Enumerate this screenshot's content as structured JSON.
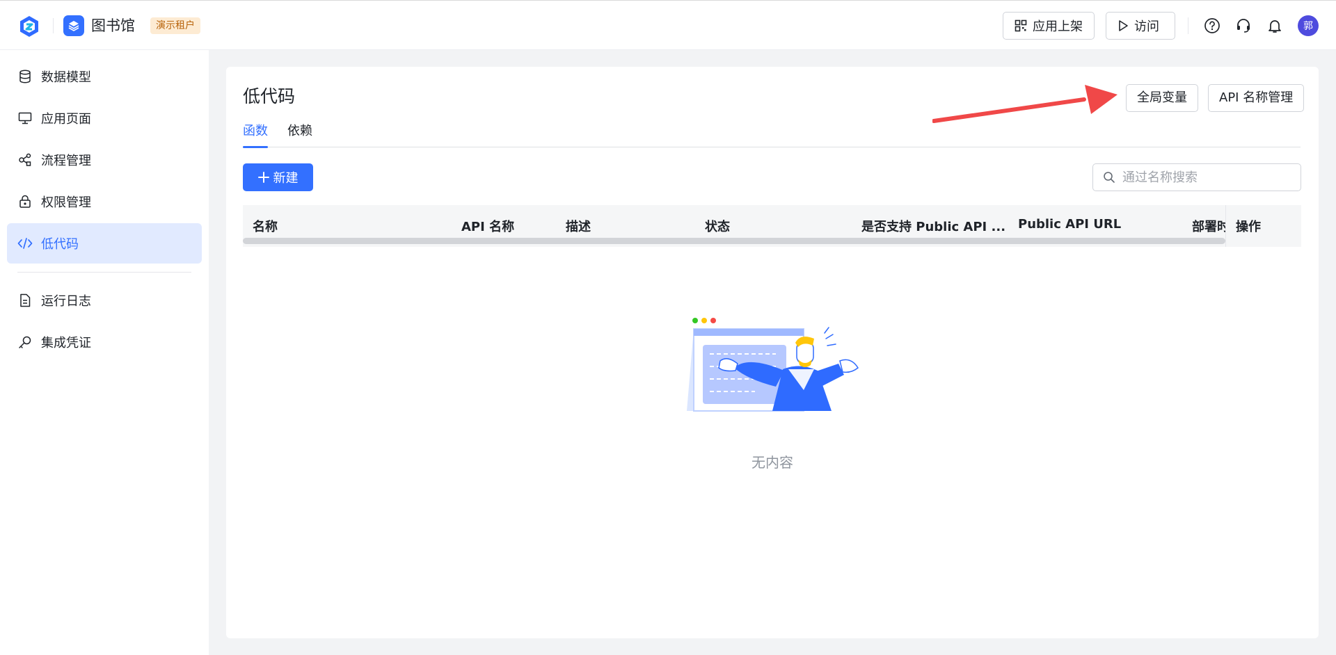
{
  "header": {
    "app_name": "图书馆",
    "tenant_badge": "演示租户",
    "publish_label": "应用上架",
    "visit_label": "访问",
    "avatar_text": "郭",
    "icons": [
      "help-icon",
      "headset-icon",
      "bell-icon"
    ]
  },
  "sidebar": {
    "items": [
      {
        "label": "数据模型",
        "icon": "database-icon"
      },
      {
        "label": "应用页面",
        "icon": "monitor-icon"
      },
      {
        "label": "流程管理",
        "icon": "workflow-icon"
      },
      {
        "label": "权限管理",
        "icon": "lock-icon"
      },
      {
        "label": "低代码",
        "icon": "code-icon",
        "active": true
      },
      {
        "label": "运行日志",
        "icon": "document-icon"
      },
      {
        "label": "集成凭证",
        "icon": "key-icon"
      }
    ]
  },
  "main": {
    "title": "低代码",
    "global_vars_label": "全局变量",
    "api_name_mgmt_label": "API 名称管理",
    "tabs": [
      {
        "label": "函数",
        "active": true
      },
      {
        "label": "依赖",
        "active": false
      }
    ],
    "new_button_label": "新建",
    "search_placeholder": "通过名称搜索",
    "table": {
      "columns": [
        "名称",
        "API 名称",
        "描述",
        "状态",
        "是否支持 Public API ...",
        "Public API URL",
        "部署时",
        "操作"
      ]
    },
    "empty_text": "无内容"
  },
  "colors": {
    "accent": "#3370ff",
    "annotation_arrow": "#f04848"
  }
}
